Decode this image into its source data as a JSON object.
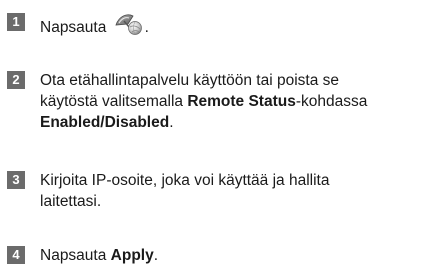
{
  "steps": [
    {
      "number": "1",
      "before": "Napsauta ",
      "icon": "satellite-dish-remote-icon",
      "after": "."
    },
    {
      "number": "2",
      "line1": "Ota etähallintapalvelu käyttöön tai poista se",
      "line2_pre": "käytöstä valitsemalla ",
      "line2_bold": "Remote Status",
      "line2_post": "-kohdassa",
      "line3_bold": "Enabled/Disabled",
      "line3_post": "."
    },
    {
      "number": "3",
      "line1": "Kirjoita IP-osoite, joka voi käyttää ja hallita",
      "line2": "laitettasi."
    },
    {
      "number": "4",
      "pre": "Napsauta ",
      "bold": "Apply",
      "post": "."
    }
  ]
}
